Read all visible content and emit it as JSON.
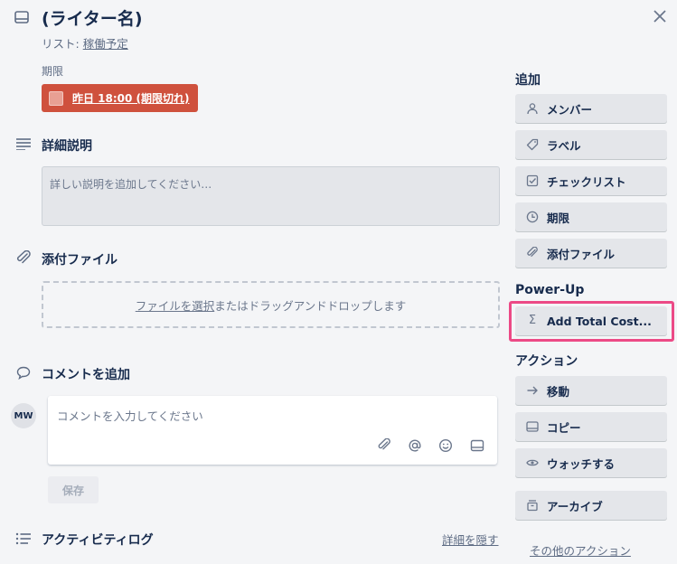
{
  "card": {
    "title": "(ライター名)",
    "list_prefix": "リスト: ",
    "list_name": "稼働予定"
  },
  "due": {
    "label": "期限",
    "badge_text": "昨日 18:00 (期限切れ)",
    "badge_color": "#cf513d"
  },
  "description": {
    "title": "詳細説明",
    "placeholder": "詳しい説明を追加してください…"
  },
  "attachments": {
    "title": "添付ファイル",
    "select_link": "ファイルを選択",
    "drop_text": "またはドラッグアンドドロップします"
  },
  "comment": {
    "title": "コメントを追加",
    "avatar_initials": "MW",
    "placeholder": "コメントを入力してください",
    "save_label": "保存",
    "icons": [
      "paperclip-icon",
      "mention-icon",
      "emoji-icon",
      "card-icon"
    ]
  },
  "activity": {
    "title": "アクティビティログ",
    "hide_details": "詳細を隠す"
  },
  "sidebar": {
    "add_heading": "追加",
    "add_buttons": [
      {
        "label": "メンバー",
        "icon": "person-icon"
      },
      {
        "label": "ラベル",
        "icon": "label-icon"
      },
      {
        "label": "チェックリスト",
        "icon": "checklist-icon"
      },
      {
        "label": "期限",
        "icon": "clock-icon"
      },
      {
        "label": "添付ファイル",
        "icon": "paperclip-icon"
      }
    ],
    "powerup_heading": "Power-Up",
    "powerup_button": {
      "label": "Add Total Cost...",
      "icon": "sigma-icon"
    },
    "highlight_color": "#ec4a86",
    "actions_heading": "アクション",
    "action_buttons": [
      {
        "label": "移動",
        "icon": "arrow-right-icon"
      },
      {
        "label": "コピー",
        "icon": "card-icon"
      },
      {
        "label": "ウォッチする",
        "icon": "eye-icon"
      },
      {
        "label": "アーカイブ",
        "icon": "archive-icon"
      }
    ],
    "other_actions": "その他のアクション"
  }
}
